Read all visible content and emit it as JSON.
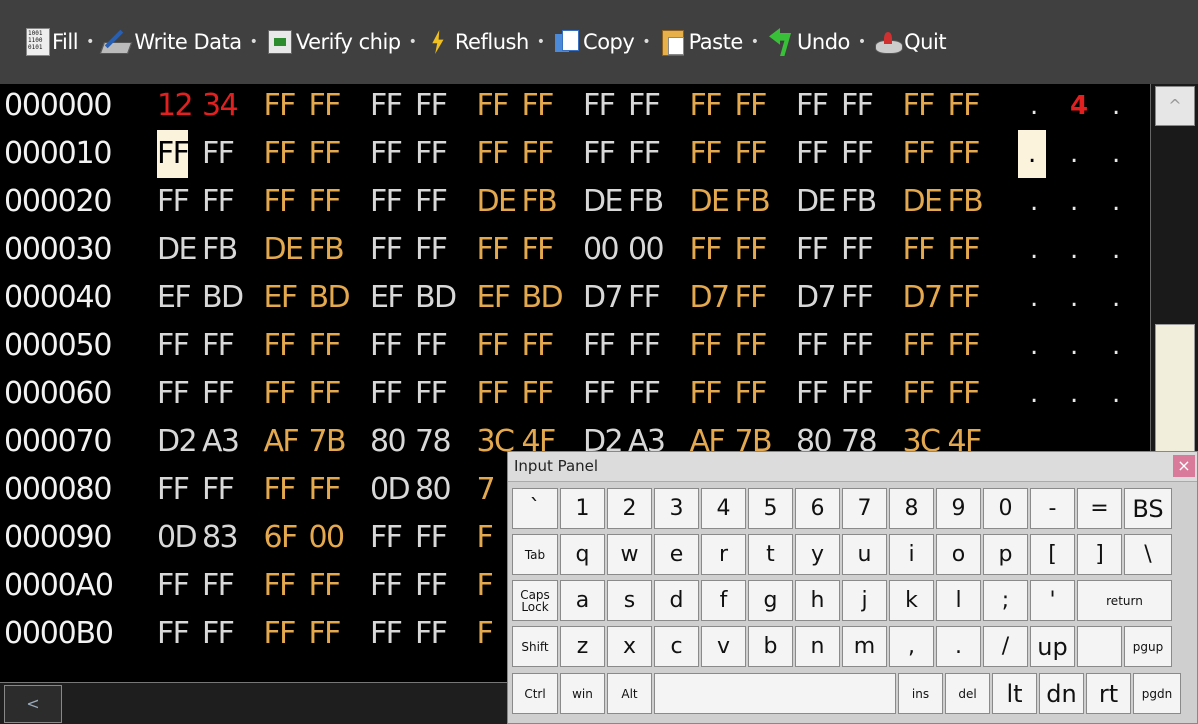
{
  "toolbar": {
    "items": [
      {
        "label": "Fill",
        "icon": "fill-icon"
      },
      {
        "label": "Write Data",
        "icon": "write-data-icon"
      },
      {
        "label": "Verify chip",
        "icon": "verify-chip-icon"
      },
      {
        "label": "Reflush",
        "icon": "reflush-icon"
      },
      {
        "label": "Copy",
        "icon": "copy-icon"
      },
      {
        "label": "Paste",
        "icon": "paste-icon"
      },
      {
        "label": "Undo",
        "icon": "undo-icon"
      },
      {
        "label": "Quit",
        "icon": "quit-icon"
      }
    ],
    "separator": "•",
    "fill_icon_text": "1001 1100 0101"
  },
  "hex": {
    "rows": [
      {
        "addr": "000000",
        "bytes": [
          "12",
          "34",
          "FF",
          "FF",
          "FF",
          "FF",
          "FF",
          "FF",
          "FF",
          "FF",
          "FF",
          "FF",
          "FF",
          "FF",
          "FF",
          "FF"
        ],
        "ascii": [
          ".",
          "4",
          "."
        ]
      },
      {
        "addr": "000010",
        "bytes": [
          "FF",
          "FF",
          "FF",
          "FF",
          "FF",
          "FF",
          "FF",
          "FF",
          "FF",
          "FF",
          "FF",
          "FF",
          "FF",
          "FF",
          "FF",
          "FF"
        ],
        "ascii": [
          ".",
          ".",
          "."
        ]
      },
      {
        "addr": "000020",
        "bytes": [
          "FF",
          "FF",
          "FF",
          "FF",
          "FF",
          "FF",
          "DE",
          "FB",
          "DE",
          "FB",
          "DE",
          "FB",
          "DE",
          "FB",
          "DE",
          "FB"
        ],
        "ascii": [
          ".",
          ".",
          "."
        ]
      },
      {
        "addr": "000030",
        "bytes": [
          "DE",
          "FB",
          "DE",
          "FB",
          "FF",
          "FF",
          "FF",
          "FF",
          "00",
          "00",
          "FF",
          "FF",
          "FF",
          "FF",
          "FF",
          "FF"
        ],
        "ascii": [
          ".",
          ".",
          "."
        ]
      },
      {
        "addr": "000040",
        "bytes": [
          "EF",
          "BD",
          "EF",
          "BD",
          "EF",
          "BD",
          "EF",
          "BD",
          "D7",
          "FF",
          "D7",
          "FF",
          "D7",
          "FF",
          "D7",
          "FF"
        ],
        "ascii": [
          ".",
          ".",
          "."
        ]
      },
      {
        "addr": "000050",
        "bytes": [
          "FF",
          "FF",
          "FF",
          "FF",
          "FF",
          "FF",
          "FF",
          "FF",
          "FF",
          "FF",
          "FF",
          "FF",
          "FF",
          "FF",
          "FF",
          "FF"
        ],
        "ascii": [
          ".",
          ".",
          "."
        ]
      },
      {
        "addr": "000060",
        "bytes": [
          "FF",
          "FF",
          "FF",
          "FF",
          "FF",
          "FF",
          "FF",
          "FF",
          "FF",
          "FF",
          "FF",
          "FF",
          "FF",
          "FF",
          "FF",
          "FF"
        ],
        "ascii": [
          ".",
          ".",
          "."
        ]
      },
      {
        "addr": "000070",
        "bytes": [
          "D2",
          "A3",
          "AF",
          "7B",
          "80",
          "78",
          "3C",
          "4F",
          "D2",
          "A3",
          "AF",
          "7B",
          "80",
          "78",
          "3C",
          "4F"
        ],
        "ascii": []
      },
      {
        "addr": "000080",
        "bytes": [
          "FF",
          "FF",
          "FF",
          "FF",
          "0D",
          "80",
          "7"
        ],
        "ascii": []
      },
      {
        "addr": "000090",
        "bytes": [
          "0D",
          "83",
          "6F",
          "00",
          "FF",
          "FF",
          "F"
        ],
        "ascii": []
      },
      {
        "addr": "0000A0",
        "bytes": [
          "FF",
          "FF",
          "FF",
          "FF",
          "FF",
          "FF",
          "F"
        ],
        "ascii": []
      },
      {
        "addr": "0000B0",
        "bytes": [
          "FF",
          "FF",
          "FF",
          "FF",
          "FF",
          "FF",
          "F"
        ],
        "ascii": []
      }
    ],
    "modified_bytes": [
      "000000:0",
      "000000:1"
    ],
    "selected_byte": "000010:0"
  },
  "colors": {
    "light_text": "#d8d8d8",
    "gold_text": "#e4a94e",
    "modified_text": "#e32020",
    "selection_bg": "#fbf3dc",
    "background": "#000000",
    "toolbar_bg": "#404040"
  },
  "scrollbars": {
    "up_arrow": "^",
    "left_arrow": "<"
  },
  "input_panel": {
    "title": "Input Panel",
    "close": "×",
    "rows": [
      [
        "`",
        "1",
        "2",
        "3",
        "4",
        "5",
        "6",
        "7",
        "8",
        "9",
        "0",
        "-",
        "=",
        "BS"
      ],
      [
        "Tab",
        "q",
        "w",
        "e",
        "r",
        "t",
        "y",
        "u",
        "i",
        "o",
        "p",
        "[",
        "]",
        "\\"
      ],
      [
        "Caps Lock",
        "a",
        "s",
        "d",
        "f",
        "g",
        "h",
        "j",
        "k",
        "l",
        ";",
        "'",
        "return"
      ],
      [
        "Shift",
        "z",
        "x",
        "c",
        "v",
        "b",
        "n",
        "m",
        ",",
        ".",
        "/",
        "up",
        "",
        "pgup"
      ],
      [
        "Ctrl",
        "win",
        "Alt",
        "",
        "ins",
        "del",
        "lt",
        "dn",
        "rt",
        "pgdn"
      ]
    ]
  }
}
